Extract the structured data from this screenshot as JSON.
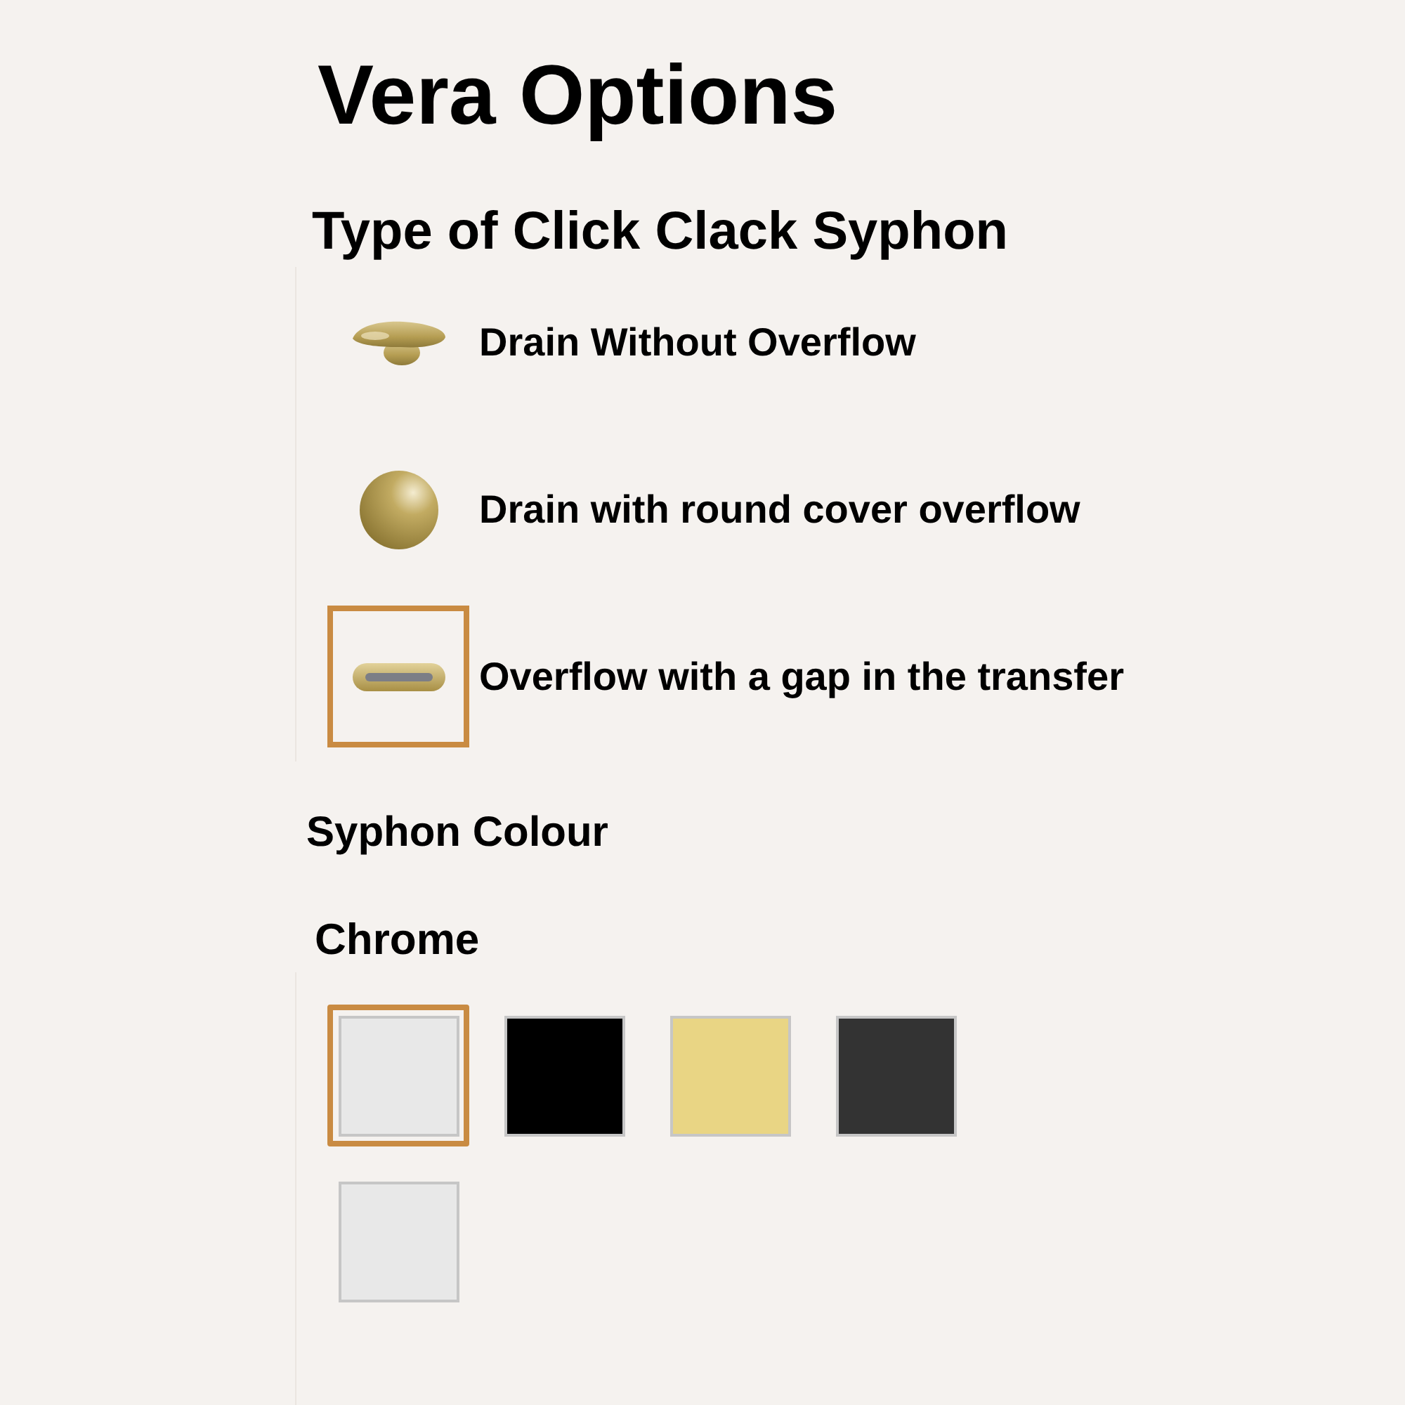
{
  "title": "Vera Options",
  "syphon_type": {
    "heading": "Type of Click Clack Syphon",
    "options": [
      {
        "kind": "cap",
        "label": "Drain Without Overflow",
        "selected": false
      },
      {
        "kind": "sphere",
        "label": "Drain with round cover overflow",
        "selected": false
      },
      {
        "kind": "slot",
        "label": "Overflow with a gap in the transfer",
        "selected": true
      }
    ]
  },
  "syphon_colour": {
    "heading": "Syphon Colour",
    "chosen_name": "Chrome",
    "swatches": [
      {
        "color": "#e8e8e8",
        "selected": true
      },
      {
        "color": "#000000",
        "selected": false
      },
      {
        "color": "#e9d584",
        "selected": false
      },
      {
        "color": "#333333",
        "selected": false
      },
      {
        "color": "#e8e8e8",
        "selected": false
      }
    ]
  }
}
